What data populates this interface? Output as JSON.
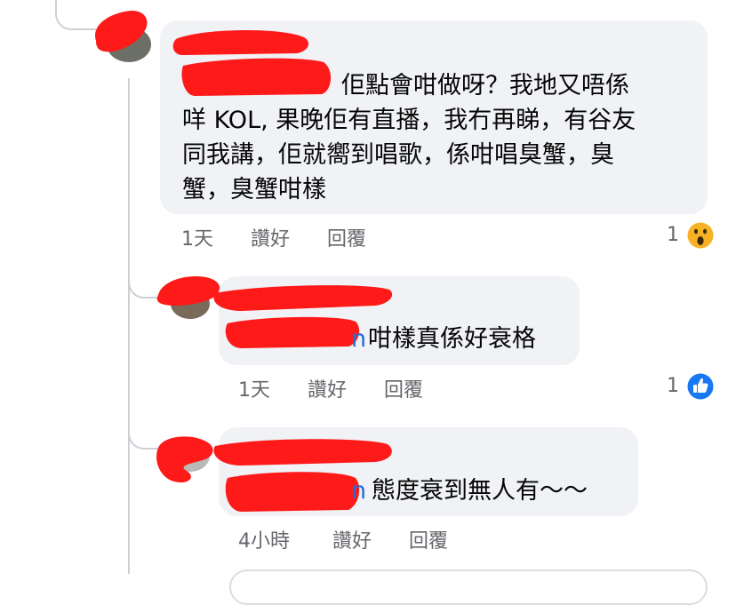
{
  "comments": [
    {
      "author_hidden": true,
      "text_lines": [
        "佢點會咁做呀？我地又唔係",
        "咩 KOL, 果晚佢有直播，我冇再睇，有谷友",
        "同我講，佢就嚮到唱歌，係咁唱臭蟹，臭",
        "蟹，臭蟹咁樣"
      ],
      "time": "1天",
      "like_label": "讚好",
      "reply_label": "回覆",
      "reaction_count": "1",
      "reaction_icon": "wow-icon",
      "reaction_color": "#f7b125"
    },
    {
      "author_hidden": true,
      "mention_tail": "n",
      "text": "咁樣真係好衰格",
      "time": "1天",
      "like_label": "讚好",
      "reply_label": "回覆",
      "reaction_count": "1",
      "reaction_icon": "like-icon",
      "reaction_color": "#1877f2"
    },
    {
      "author_hidden": true,
      "mention_tail": "n",
      "text": "態度衰到無人有～～",
      "time": "4小時",
      "like_label": "讚好",
      "reply_label": "回覆"
    }
  ],
  "colors": {
    "bubble_bg": "#f0f2f5",
    "meta_text": "#65676b",
    "mention_link": "#216fdb",
    "redaction": "#ff1a1a",
    "thread_line": "#ccd0d5"
  }
}
